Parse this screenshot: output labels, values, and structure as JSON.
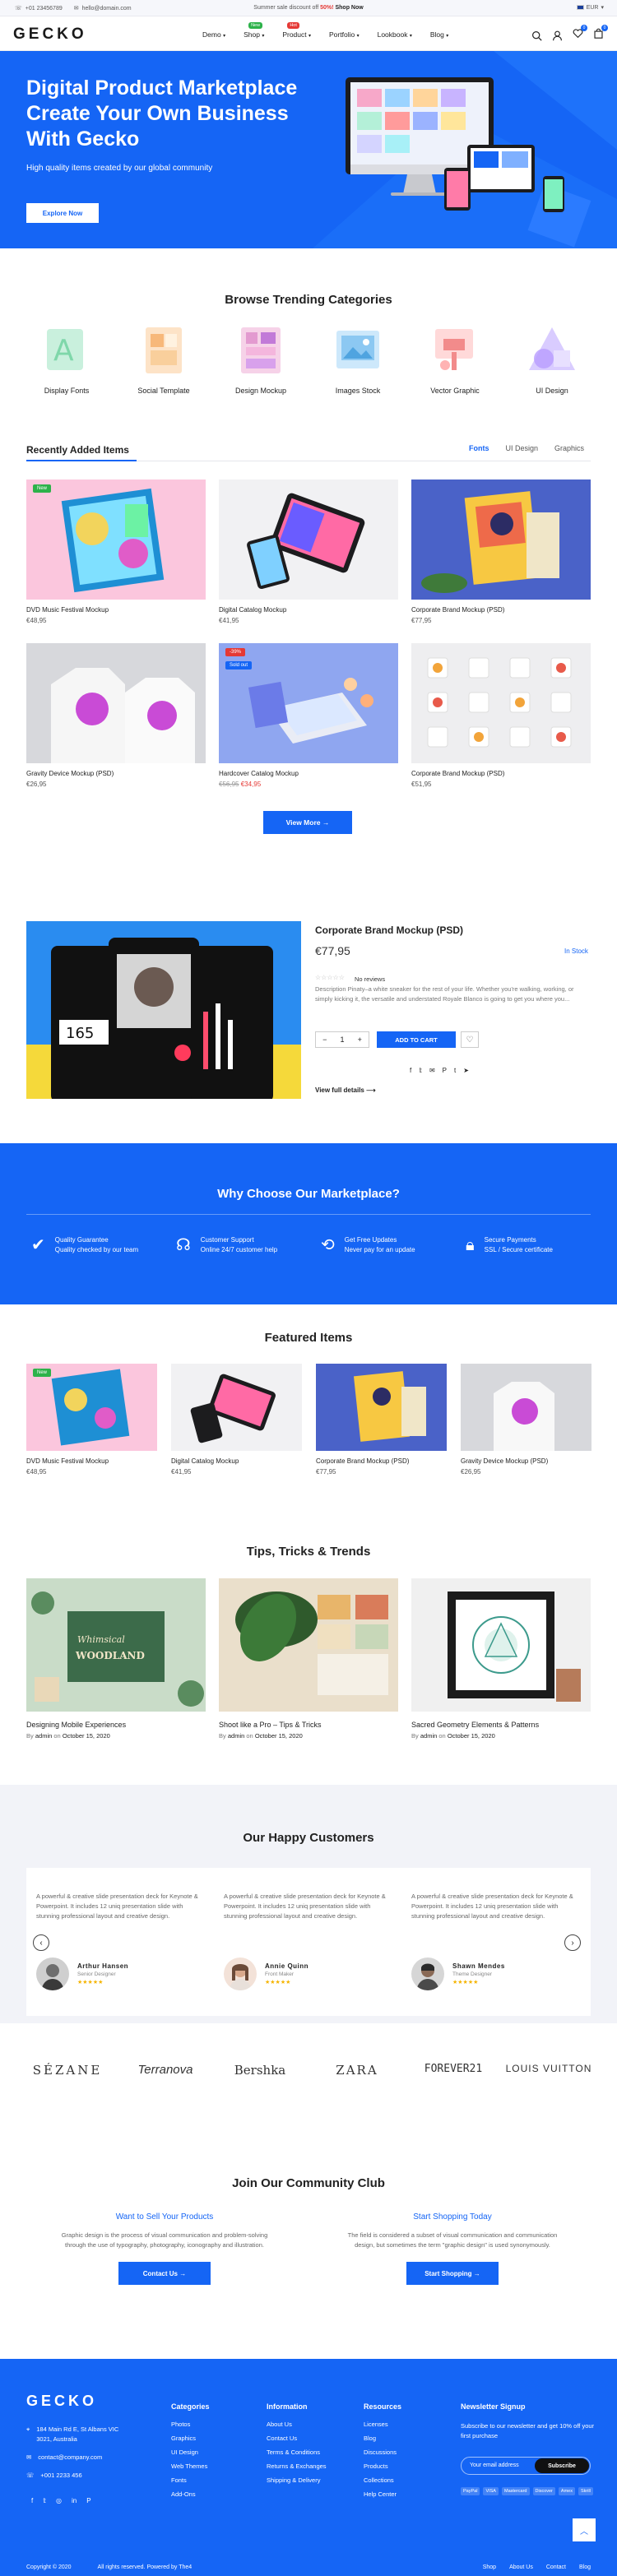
{
  "topbar": {
    "phone": "+01 23456789",
    "email": "hello@domain.com",
    "promo_text": "Summer sale discount off",
    "promo_highlight": "50%!",
    "promo_link": "Shop Now",
    "currency": "EUR"
  },
  "header": {
    "logo": "GECKO",
    "nav": [
      {
        "label": "Demo",
        "badge": ""
      },
      {
        "label": "Shop",
        "badge": "New"
      },
      {
        "label": "Product",
        "badge": "Hot"
      },
      {
        "label": "Portfolio",
        "badge": ""
      },
      {
        "label": "Lookbook",
        "badge": ""
      },
      {
        "label": "Blog",
        "badge": ""
      }
    ],
    "cart_count": "0",
    "wishlist_count": "0"
  },
  "hero": {
    "title": "Digital Product Marketplace Create Your Own Business With Gecko",
    "subtitle": "High quality items created by our global community",
    "button": "Explore Now"
  },
  "categories": {
    "title": "Browse Trending Categories",
    "items": [
      "Display Fonts",
      "Social Template",
      "Design Mockup",
      "Images Stock",
      "Vector Graphic",
      "UI Design"
    ]
  },
  "recent": {
    "title": "Recently Added Items",
    "tabs": [
      "Fonts",
      "UI Design",
      "Graphics"
    ],
    "products": [
      {
        "name": "DVD Music Festival Mockup",
        "price": "€48,95",
        "old_price": "",
        "label": "New"
      },
      {
        "name": "Digital Catalog Mockup",
        "price": "€41,95",
        "old_price": "",
        "label": ""
      },
      {
        "name": "Corporate Brand Mockup (PSD)",
        "price": "€77,95",
        "old_price": "",
        "label": ""
      },
      {
        "name": "Gravity Device Mockup (PSD)",
        "price": "€26,95",
        "old_price": "",
        "label": ""
      },
      {
        "name": "Hardcover Catalog Mockup",
        "price": "€34,95",
        "old_price": "€56,95",
        "label": "-39%"
      },
      {
        "name": "Corporate Brand Mockup (PSD)",
        "price": "€51,95",
        "old_price": "",
        "label": ""
      }
    ],
    "view_more": "View More"
  },
  "quickview": {
    "title": "Corporate Brand Mockup (PSD)",
    "price": "€77,95",
    "stock": "In Stock",
    "reviews": "No reviews",
    "description": "Description Pinaty–a white sneaker for the rest of your life. Whether you're walking, working, or simply kicking it, the versatile and understated Royale Blanco is going to get you where you...",
    "qty": "1",
    "add_to_cart": "ADD TO CART",
    "full_details": "View full details"
  },
  "why": {
    "title": "Why Choose Our Marketplace?",
    "features": [
      {
        "title": "Quality Guarantee",
        "desc": "Quality checked by our team"
      },
      {
        "title": "Customer Support",
        "desc": "Online 24/7 customer help"
      },
      {
        "title": "Get Free Updates",
        "desc": "Never pay for an update"
      },
      {
        "title": "Secure Payments",
        "desc": "SSL / Secure certificate"
      }
    ]
  },
  "featured": {
    "title": "Featured Items",
    "products": [
      {
        "name": "DVD Music Festival Mockup",
        "price": "€48,95",
        "label": "New"
      },
      {
        "name": "Digital Catalog Mockup",
        "price": "€41,95",
        "label": ""
      },
      {
        "name": "Corporate Brand Mockup (PSD)",
        "price": "€77,95",
        "label": ""
      },
      {
        "name": "Gravity Device Mockup (PSD)",
        "price": "€26,95",
        "label": ""
      }
    ]
  },
  "blog": {
    "title": "Tips, Tricks & Trends",
    "by": "By",
    "on": "on",
    "posts": [
      {
        "title": "Designing Mobile Experiences",
        "author": "admin",
        "date": "October 15, 2020",
        "image_text": "Whimsical WOODLAND"
      },
      {
        "title": "Shoot like a Pro – Tips & Tricks",
        "author": "admin",
        "date": "October 15, 2020",
        "image_text": ""
      },
      {
        "title": "Sacred Geometry Elements & Patterns",
        "author": "admin",
        "date": "October 15, 2020",
        "image_text": ""
      }
    ]
  },
  "customers": {
    "title": "Our Happy Customers",
    "testimonials": [
      {
        "text": "A powerful & creative slide presentation deck for Keynote & Powerpoint. It includes 12 uniq presentation slide with stunning professional layout and creative design.",
        "name": "Arthur Hansen",
        "role": "Senior Designer",
        "stars": "★★★★★"
      },
      {
        "text": "A powerful & creative slide presentation deck for Keynote & Powerpoint. It includes 12 uniq presentation slide with stunning professional layout and creative design.",
        "name": "Annie Quinn",
        "role": "Front Maker",
        "stars": "★★★★★"
      },
      {
        "text": "A powerful & creative slide presentation deck for Keynote & Powerpoint. It includes 12 uniq presentation slide with stunning professional layout and creative design.",
        "name": "Shawn Mendes",
        "role": "Theme Designer",
        "stars": "★★★★★"
      }
    ],
    "brands": [
      "SÉZANE",
      "Terranova",
      "Bershka",
      "ZARA",
      "FOREVER21",
      "LOUIS VUITTON"
    ]
  },
  "community": {
    "title": "Join Our Community Club",
    "blocks": [
      {
        "title": "Want to Sell Your Products",
        "desc": "Graphic design is the process of visual communication and problem-solving through the use of typography, photography, iconography and illustration.",
        "button": "Contact Us"
      },
      {
        "title": "Start Shopping Today",
        "desc": "The field is considered a subset of visual communication and communication design, but sometimes the term \"graphic design\" is used synonymously.",
        "button": "Start Shopping"
      }
    ]
  },
  "footer": {
    "logo": "GECKO",
    "address": "184 Main Rd E, St Albans VIC 3021, Australia",
    "email": "contact@company.com",
    "phone": "+001 2233 456",
    "columns": [
      {
        "heading": "Categories",
        "links": [
          "Photos",
          "Graphics",
          "UI Design",
          "Web Themes",
          "Fonts",
          "Add-Ons"
        ]
      },
      {
        "heading": "Information",
        "links": [
          "About Us",
          "Contact Us",
          "Terms & Conditions",
          "Returns & Exchanges",
          "Shipping & Delivery"
        ]
      },
      {
        "heading": "Resources",
        "links": [
          "Licenses",
          "Blog",
          "Discussions",
          "Products",
          "Collections",
          "Help Center"
        ]
      }
    ],
    "newsletter_heading": "Newsletter Signup",
    "newsletter_text": "Subscribe to our newsletter and get 10% off your first purchase",
    "newsletter_placeholder": "Your email address",
    "newsletter_button": "Subscribe",
    "payments": [
      "PayPal",
      "VISA",
      "Mastercard",
      "Discover",
      "Amex",
      "Skrill"
    ],
    "copyright": "Copyright © 2020",
    "rights": "All rights reserved. Powered by The4",
    "bottom_links": [
      "Shop",
      "About Us",
      "Contact",
      "Blog"
    ]
  },
  "colors": {
    "accent": "#1565f5",
    "sale": "#e53935",
    "new_badge": "#2db24a",
    "hot_badge": "#e53935"
  }
}
